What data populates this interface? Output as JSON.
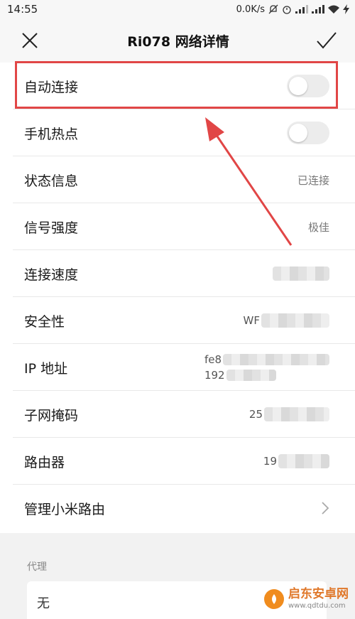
{
  "status_bar": {
    "time": "14:55",
    "speed": "0.0K/s"
  },
  "header": {
    "title": "Ri078  网络详情",
    "close_icon": "close-icon",
    "confirm_icon": "check-icon"
  },
  "rows": {
    "auto_connect": {
      "label": "自动连接",
      "enabled": false
    },
    "hotspot": {
      "label": "手机热点",
      "enabled": false
    },
    "status": {
      "label": "状态信息",
      "value": "已连接"
    },
    "signal": {
      "label": "信号强度",
      "value": "极佳"
    },
    "speed": {
      "label": "连接速度"
    },
    "security": {
      "label": "安全性",
      "value_prefix": "WF"
    },
    "ip": {
      "label": "IP 地址",
      "line1_prefix": "fe8",
      "line2_prefix": "192"
    },
    "subnet": {
      "label": "子网掩码",
      "value_prefix": "25"
    },
    "router": {
      "label": "路由器",
      "value_prefix": "19"
    },
    "manage": {
      "label": "管理小米路由"
    }
  },
  "proxy": {
    "label": "代理",
    "value": "无"
  },
  "watermark": {
    "name": "启东安卓网",
    "url": "www.qdtdu.com"
  },
  "colors": {
    "highlight": "#e14646",
    "background": "#f2f2f2",
    "toggle_off": "#ececec"
  }
}
